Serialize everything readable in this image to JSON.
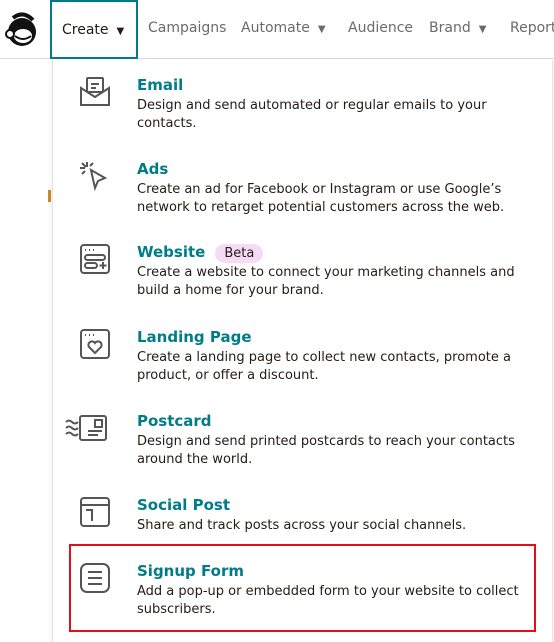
{
  "nav": {
    "create": "Create",
    "campaigns": "Campaigns",
    "automate": "Automate",
    "audience": "Audience",
    "brand": "Brand",
    "reports": "Report"
  },
  "menu": [
    {
      "title": "Email",
      "desc": "Design and send automated or regular emails to your contacts.",
      "icon": "email-icon"
    },
    {
      "title": "Ads",
      "desc": "Create an ad for Facebook or Instagram or use Google’s network to retarget potential customers across the web.",
      "icon": "cursor-click-icon"
    },
    {
      "title": "Website",
      "badge": "Beta",
      "desc": "Create a website to connect your marketing channels and build a home for your brand.",
      "icon": "website-icon"
    },
    {
      "title": "Landing Page",
      "desc": "Create a landing page to collect new contacts, promote a product, or offer a discount.",
      "icon": "landing-page-icon"
    },
    {
      "title": "Postcard",
      "desc": "Design and send printed postcards to reach your contacts around the world.",
      "icon": "postcard-icon"
    },
    {
      "title": "Social Post",
      "desc": "Share and track posts across your social channels.",
      "icon": "social-post-icon"
    },
    {
      "title": "Signup Form",
      "desc": "Add a pop-up or embedded form to your website to collect subscribers.",
      "icon": "signup-form-icon"
    }
  ],
  "colors": {
    "accent": "#007c89",
    "highlight": "#e0101a",
    "badge": "#f6dbf5"
  }
}
